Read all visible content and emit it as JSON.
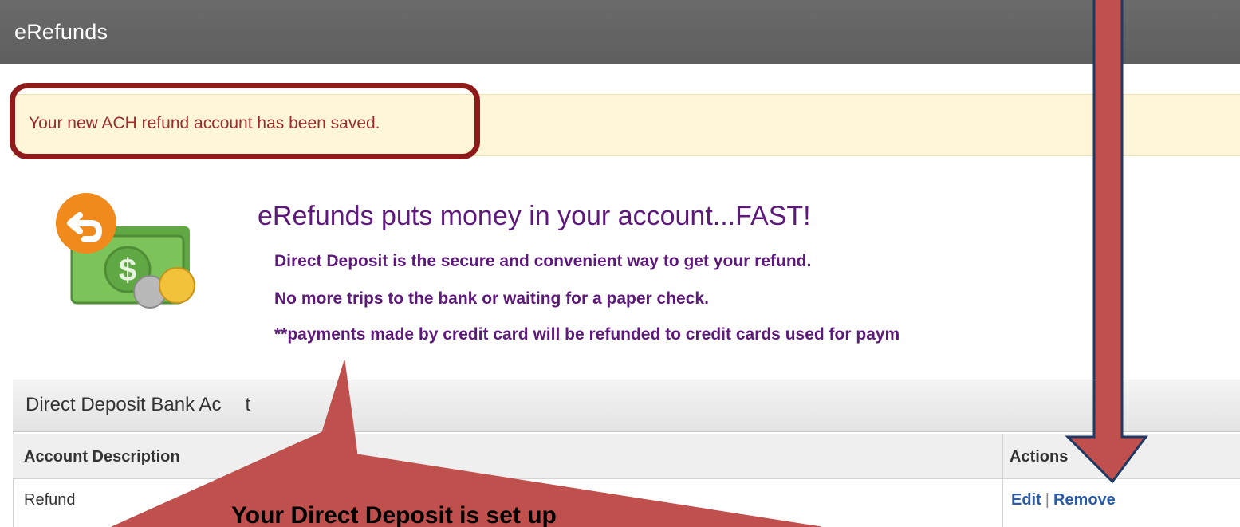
{
  "window": {
    "title": "eRefunds"
  },
  "notification": {
    "message": "Your new ACH refund account has been saved."
  },
  "promo": {
    "heading": "eRefunds puts money in your account...FAST!",
    "lines": [
      "Direct Deposit is the secure and convenient way to get your refund.",
      "No more trips to the bank or waiting for a paper check.",
      "**payments made by credit card will be refunded to credit cards used for paym"
    ],
    "icon": "money-refund-icon"
  },
  "panel": {
    "title": "Direct Deposit Bank Ac",
    "title_tail": "t",
    "columns": [
      "Account Description",
      "Actions"
    ],
    "rows": [
      {
        "description": "Refund",
        "actions": {
          "edit": "Edit",
          "separator": "|",
          "remove": "Remove"
        }
      }
    ]
  },
  "callout": {
    "text": "Your Direct Deposit is set up"
  },
  "colors": {
    "title_bar": "#666666",
    "banner_bg": "#fff6d8",
    "banner_text": "#9c2b2b",
    "highlight_border": "#8e1a1a",
    "promo_text": "#5d1a7a",
    "link": "#2a5aa8",
    "arrow_fill": "#c0504d",
    "arrow_stroke": "#1f3864"
  }
}
